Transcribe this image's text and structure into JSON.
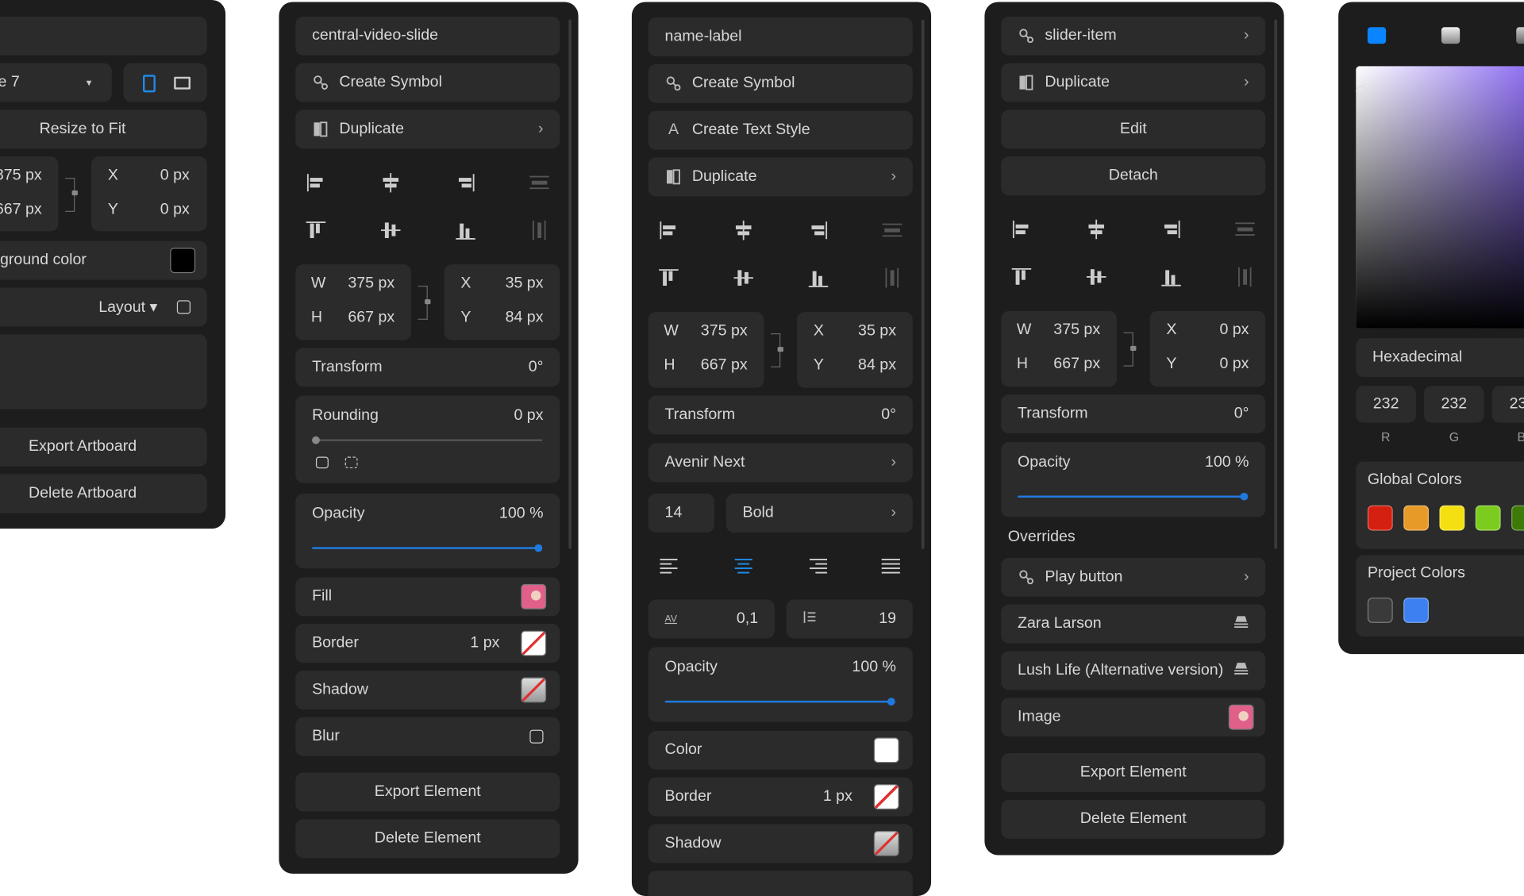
{
  "colors": {
    "accent": "#1f7ae0",
    "panel": "#1d1d1d",
    "row": "#2b2b2b"
  },
  "artboard": {
    "device": "e 7",
    "resize": "Resize to Fit",
    "w": "375 px",
    "h": "667 px",
    "x_label": "X",
    "y_label": "Y",
    "x": "0 px",
    "y": "0 px",
    "bg_label": "ground color",
    "layout": "Layout ▾",
    "export": "Export Artboard",
    "delete": "Delete Artboard"
  },
  "video": {
    "name": "central-video-slide",
    "create_symbol": "Create Symbol",
    "duplicate": "Duplicate",
    "w_label": "W",
    "h_label": "H",
    "w": "375 px",
    "h": "667 px",
    "x_label": "X",
    "y_label": "Y",
    "x": "35 px",
    "y": "84 px",
    "transform": "Transform",
    "transform_val": "0°",
    "rounding": "Rounding",
    "rounding_val": "0 px",
    "opacity": "Opacity",
    "opacity_val": "100 %",
    "opacity_fraction": 1.0,
    "fill": "Fill",
    "border": "Border",
    "border_val": "1 px",
    "shadow": "Shadow",
    "blur": "Blur",
    "export": "Export Element",
    "delete": "Delete Element"
  },
  "label": {
    "name": "name-label",
    "create_symbol": "Create Symbol",
    "create_text_style": "Create Text Style",
    "text_style_icon": "A",
    "duplicate": "Duplicate",
    "w_label": "W",
    "h_label": "H",
    "w": "375 px",
    "h": "667 px",
    "x_label": "X",
    "y_label": "Y",
    "x": "35 px",
    "y": "84 px",
    "transform": "Transform",
    "transform_val": "0°",
    "font": "Avenir Next",
    "size": "14",
    "weight": "Bold",
    "letter_icon": "AV",
    "letter_spacing": "0,1",
    "line_height": "19",
    "opacity": "Opacity",
    "opacity_val": "100 %",
    "opacity_fraction": 1.0,
    "color": "Color",
    "border": "Border",
    "border_val": "1 px",
    "shadow": "Shadow"
  },
  "slider": {
    "name": "slider-item",
    "duplicate": "Duplicate",
    "edit": "Edit",
    "detach": "Detach",
    "w_label": "W",
    "h_label": "H",
    "w": "375 px",
    "h": "667 px",
    "x_label": "X",
    "y_label": "Y",
    "x": "0 px",
    "y": "0 px",
    "transform": "Transform",
    "transform_val": "0°",
    "opacity": "Opacity",
    "opacity_val": "100 %",
    "opacity_fraction": 1.0,
    "overrides": "Overrides",
    "play": "Play button",
    "text1": "Zara Larson",
    "text2": "Lush Life (Alternative version)",
    "image": "Image",
    "export": "Export Element",
    "delete": "Delete Element"
  },
  "picker": {
    "format": "Hexadecimal",
    "r": "232",
    "g": "232",
    "b": "23",
    "r_label": "R",
    "g_label": "G",
    "b_label": "B",
    "global": "Global Colors",
    "global_colors": [
      "#d42010",
      "#e89a28",
      "#f4e010",
      "#7ccc20",
      "#3d7a08"
    ],
    "project": "Project Colors",
    "project_colors": [
      "#3a3a3a",
      "#3d80f0"
    ]
  }
}
